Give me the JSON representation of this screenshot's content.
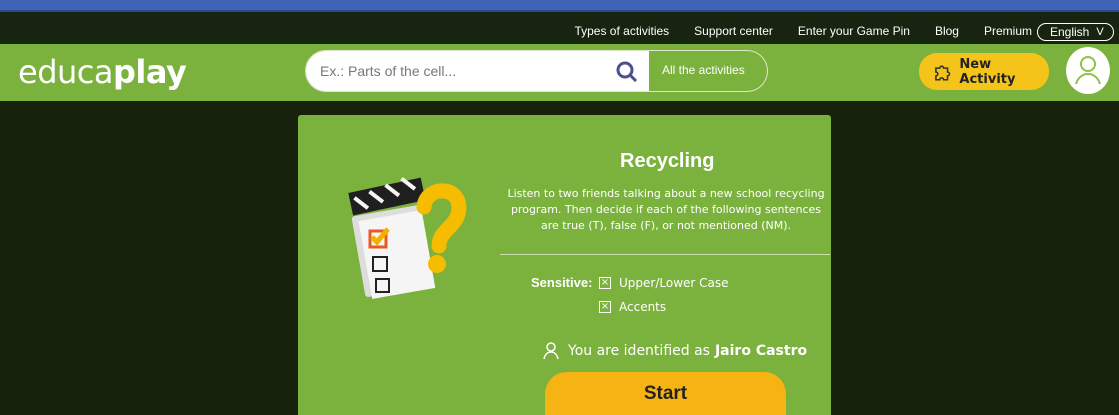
{
  "topbar": {
    "links": [
      "Types of activities",
      "Support center",
      "Enter your Game Pin",
      "Blog",
      "Premium"
    ],
    "language": "English"
  },
  "header": {
    "logo_light": "educa",
    "logo_bold": "play",
    "search_placeholder": "Ex.: Parts of the cell...",
    "all_activities": "All the activities",
    "new_activity": "New Activity"
  },
  "activity": {
    "title": "Recycling",
    "description": "Listen to two friends talking about a new school recycling program. Then decide if each of the following sentences are true (T), false (F), or not mentioned (NM).",
    "sensitive_label": "Sensitive:",
    "options": [
      "Upper/Lower Case",
      "Accents"
    ],
    "identified_prefix": "You are identified as",
    "identified_name": "Jairo Castro",
    "start_label": "Start"
  },
  "colors": {
    "header_green": "#7bb23e",
    "button_yellow": "#f4c41b",
    "dark_bg": "#17220c"
  }
}
